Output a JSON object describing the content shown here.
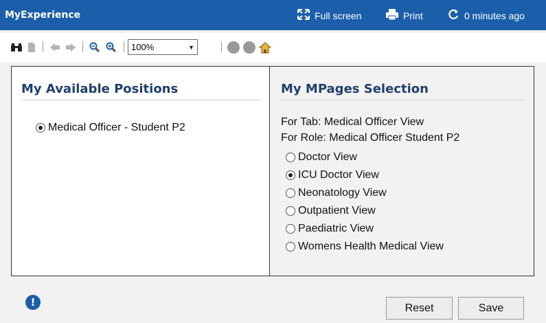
{
  "titlebar": {
    "title": "MyExperience",
    "fullscreen_label": "Full screen",
    "print_label": "Print",
    "refresh_label": "0 minutes ago"
  },
  "toolbar": {
    "zoom_value": "100%",
    "icons": [
      "binoculars-icon",
      "page-icon",
      "back-icon",
      "forward-icon",
      "zoom-out-icon",
      "zoom-in-icon",
      "stop-icon",
      "refresh-icon",
      "home-icon"
    ]
  },
  "left_pane": {
    "title": "My Available Positions",
    "positions": [
      {
        "label": "Medical Officer - Student P2",
        "selected": true
      }
    ]
  },
  "right_pane": {
    "title": "My MPages Selection",
    "for_tab": "For Tab:  Medical Officer View",
    "for_role": "For Role:  Medical Officer Student P2",
    "views": [
      {
        "label": "Doctor View",
        "selected": false
      },
      {
        "label": "ICU Doctor View",
        "selected": true
      },
      {
        "label": "Neonatology View",
        "selected": false
      },
      {
        "label": "Outpatient View",
        "selected": false
      },
      {
        "label": "Paediatric View",
        "selected": false
      },
      {
        "label": "Womens Health Medical View",
        "selected": false
      }
    ]
  },
  "footer": {
    "info_glyph": "!",
    "reset_label": "Reset",
    "save_label": "Save"
  },
  "colors": {
    "titlebar": "#1b5faa",
    "pane_title": "#1f3f6f"
  }
}
